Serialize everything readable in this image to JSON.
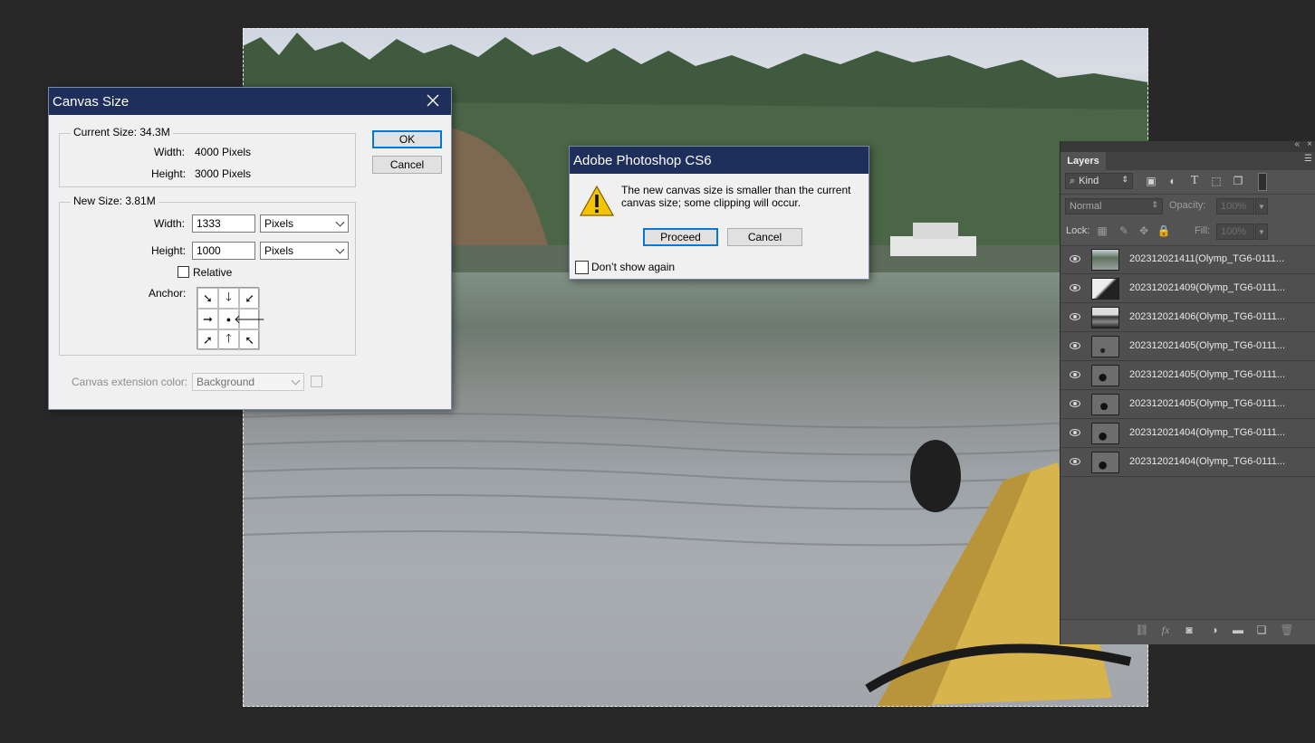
{
  "canvas_size_dialog": {
    "title": "Canvas Size",
    "current_size_label": "Current Size: 34.3M",
    "current_width_label": "Width:",
    "current_width_value": "4000 Pixels",
    "current_height_label": "Height:",
    "current_height_value": "3000 Pixels",
    "new_size_label": "New Size: 3.81M",
    "width_label": "Width:",
    "width_value": "1333",
    "width_unit": "Pixels",
    "height_label": "Height:",
    "height_value": "1000",
    "height_unit": "Pixels",
    "relative_label": "Relative",
    "anchor_label": "Anchor:",
    "anchor_cells": [
      "➘",
      "🡓",
      "➚",
      "➞",
      "●",
      "🡐",
      "➚",
      "🡑",
      "➘"
    ],
    "extension_color_label": "Canvas extension color:",
    "extension_color_value": "Background",
    "ok_label": "OK",
    "cancel_label": "Cancel"
  },
  "alert_dialog": {
    "title": "Adobe Photoshop CS6",
    "message_line1": "The new canvas size is smaller than the current",
    "message_line2": "canvas size; some clipping will occur.",
    "proceed_label": "Proceed",
    "cancel_label": "Cancel",
    "dont_show_label": "Don’t show again"
  },
  "layers_panel": {
    "tab_label": "Layers",
    "filter_label": "Kind",
    "blend_mode": "Normal",
    "opacity_label": "Opacity:",
    "opacity_value": "100%",
    "lock_label": "Lock:",
    "fill_label": "Fill:",
    "fill_value": "100%",
    "layers": [
      {
        "name": "202312021411(Olymp_TG6-0111..."
      },
      {
        "name": "202312021409(Olymp_TG6-0111..."
      },
      {
        "name": "202312021406(Olymp_TG6-0111..."
      },
      {
        "name": "202312021405(Olymp_TG6-0111..."
      },
      {
        "name": "202312021405(Olymp_TG6-0111..."
      },
      {
        "name": "202312021405(Olymp_TG6-0111..."
      },
      {
        "name": "202312021404(Olymp_TG6-0111..."
      },
      {
        "name": "202312021404(Olymp_TG6-0111..."
      }
    ],
    "footer_icons": [
      "link-icon",
      "fx-icon",
      "mask-icon",
      "adjustment-icon",
      "folder-icon",
      "new-layer-icon",
      "trash-icon"
    ]
  },
  "colors": {
    "dialog_title_bar": "#1e2f5c",
    "dialog_bg": "#f0f0f0",
    "workspace_bg": "#282828",
    "panel_bg": "#535353",
    "default_button_border": "#0078d7"
  }
}
